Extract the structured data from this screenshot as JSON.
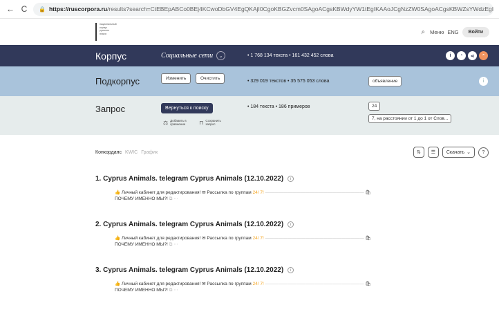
{
  "browser": {
    "back": "←",
    "reload": "C",
    "url_host": "https://ruscorpora.ru",
    "url_rest": "/results?search=CtEBEpABCo0BEj4KCwoDbGV4EgQKAjI0CgoKBGZvcm0SAgoACgsKBWdyYW1tEgIKAAoJCgNzZW0SAgoACgsKBWZsYWdzEgIKABILCgoKA2xleBIDCgE3..."
  },
  "header": {
    "logo_lines": [
      "национальный",
      "корпус",
      "русского",
      "языка"
    ],
    "menu": "Меню",
    "lang": "ENG",
    "login": "Войти"
  },
  "corpus": {
    "title": "Корпус",
    "genre": "Социальные сети",
    "stats": "• 1 768 134 текста • 161 432 452 слова"
  },
  "subcorpus": {
    "title": "Подкорпус",
    "change": "Изменить",
    "clear": "Очистить",
    "stats": "• 329 019 текстов • 35 575 053 слова",
    "announce": "объявление"
  },
  "query": {
    "title": "Запрос",
    "back_to_search": "Вернуться к поиску",
    "stats": "• 184 текста • 186 примеров",
    "add_compare": "Добавить в сравнение",
    "save_query": "Сохранить запрос",
    "term": "24",
    "distance": "7, на расстоянии от 1 до 1 от Слов..."
  },
  "tabs": [
    "Конкорданс",
    "KWIC",
    "График"
  ],
  "toolbar": {
    "download": "Скачать",
    "help": "?"
  },
  "results": [
    {
      "title": "1. Cyprus Animals. telegram Cyprus Animals (12.10.2022)",
      "text_a": "Личный кабинет для редактирования!",
      "text_b": "Рассылка по группам",
      "hit": "24/ 7!",
      "text_c": "ПОЧЕМУ ИМЕННО МЫ?!"
    },
    {
      "title": "2. Cyprus Animals. telegram Cyprus Animals (12.10.2022)",
      "text_a": "Личный кабинет для редактирования!",
      "text_b": "Рассылка по группам",
      "hit": "24/ 7!",
      "text_c": "ПОЧЕМУ ИМЕННО МЫ?!"
    },
    {
      "title": "3. Cyprus Animals. telegram Cyprus Animals (12.10.2022)",
      "text_a": "Личный кабинет для редактирования!",
      "text_b": "Рассылка по группам",
      "hit": "24/ 7!",
      "text_c": "ПОЧЕМУ ИМЕННО МЫ?!"
    }
  ],
  "colors": {
    "corpus_band": "#31395a",
    "subcorpus_band": "#a9c3db",
    "query_band": "#e6ecec",
    "accent": "#f0935f",
    "hit": "#f5a623"
  }
}
